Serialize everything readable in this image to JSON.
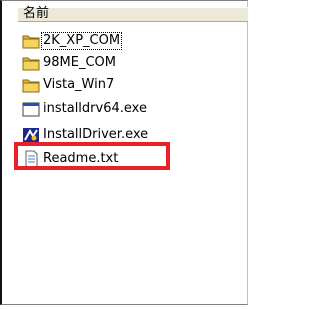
{
  "header": {
    "name_label": "名前"
  },
  "files": [
    {
      "name": "2K_XP_COM",
      "icon": "folder-icon",
      "focused": true
    },
    {
      "name": "98ME_COM",
      "icon": "folder-icon"
    },
    {
      "name": "Vista_Win7",
      "icon": "folder-icon"
    },
    {
      "name": "installdrv64.exe",
      "icon": "exe-window-icon"
    },
    {
      "name": "InstallDriver.exe",
      "icon": "installer-icon",
      "highlighted": true
    },
    {
      "name": "Readme.txt",
      "icon": "text-file-icon"
    }
  ],
  "colors": {
    "highlight_border": "#e8202a",
    "folder_yellow": "#f4d35e",
    "header_bg": "#ece9d8"
  }
}
